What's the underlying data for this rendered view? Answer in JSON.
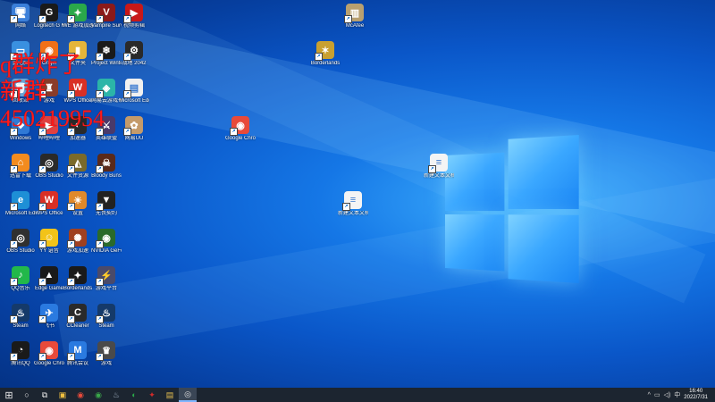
{
  "desktop": {
    "icons": [
      {
        "id": "c1r1",
        "label": "网络",
        "glyph": "🖥",
        "color": "#3b7fd9"
      },
      {
        "id": "c2r1",
        "label": "Logitech G HUB",
        "glyph": "G",
        "color": "#1a1a1a"
      },
      {
        "id": "c3r1",
        "label": "WE 游戏加速器",
        "glyph": "✦",
        "color": "#2aa84a"
      },
      {
        "id": "c4r1",
        "label": "Vampire Survivors",
        "glyph": "V",
        "color": "#8b1a1a"
      },
      {
        "id": "c5r1",
        "label": "视频剪辑",
        "glyph": "▶",
        "color": "#c81818"
      },
      {
        "id": "c1r2",
        "label": "此电脑",
        "glyph": "▭",
        "color": "#3a90e0"
      },
      {
        "id": "c2r2",
        "label": "Origin",
        "glyph": "◉",
        "color": "#f07018"
      },
      {
        "id": "c3r2",
        "label": "文件夹",
        "glyph": "▮",
        "color": "#e5b53a"
      },
      {
        "id": "c4r2",
        "label": "Project Winter",
        "glyph": "❄",
        "color": "#1a1a1a"
      },
      {
        "id": "c5r2",
        "label": "战地 2042",
        "glyph": "⚙",
        "color": "#2a2a2a"
      },
      {
        "id": "c1r3",
        "label": "回收站",
        "glyph": "🗑",
        "color": "#6aa6d6"
      },
      {
        "id": "c2r3",
        "label": "游戏",
        "glyph": "♜",
        "color": "#8a3c2a"
      },
      {
        "id": "c3r3",
        "label": "WPS Office",
        "glyph": "W",
        "color": "#d93025"
      },
      {
        "id": "c4r3",
        "label": "网易云游戏平台",
        "glyph": "◈",
        "color": "#2bb5a8"
      },
      {
        "id": "c5r3",
        "label": "Microsoft Edge",
        "glyph": "▤",
        "color": "#f0f0f0"
      },
      {
        "id": "c1r4",
        "label": "Windows",
        "glyph": "❖",
        "color": "#3079d6"
      },
      {
        "id": "c2r4",
        "label": "哔哩哔哩",
        "glyph": "▶",
        "color": "#e04040"
      },
      {
        "id": "c3r4",
        "label": "加速器",
        "glyph": "◐",
        "color": "#2a2a2a"
      },
      {
        "id": "c4r4",
        "label": "英雄联盟",
        "glyph": "⚔",
        "color": "#4a3a6a"
      },
      {
        "id": "c5r4",
        "label": "网易UU",
        "glyph": "✿",
        "color": "#c49a6a"
      },
      {
        "id": "c1r5",
        "label": "迅雷下载",
        "glyph": "⌂",
        "color": "#f28b1e"
      },
      {
        "id": "c2r5",
        "label": "OBS Studio",
        "glyph": "◎",
        "color": "#2a2a2a"
      },
      {
        "id": "c3r5",
        "label": "文件资源",
        "glyph": "◭",
        "color": "#7a6a2a"
      },
      {
        "id": "c4r5",
        "label": "Bloody Buns",
        "glyph": "☠",
        "color": "#5a2a1a"
      },
      {
        "id": "c1r6",
        "label": "Microsoft Edge",
        "glyph": "e",
        "color": "#1e8fd6"
      },
      {
        "id": "c2r6",
        "label": "WPS Office",
        "glyph": "W",
        "color": "#d93025"
      },
      {
        "id": "c3r6",
        "label": "设置",
        "glyph": "☀",
        "color": "#e0892a"
      },
      {
        "id": "c4r6",
        "label": "无畏契约",
        "glyph": "▼",
        "color": "#222"
      },
      {
        "id": "c1r7",
        "label": "OBS Studio",
        "glyph": "◎",
        "color": "#303030"
      },
      {
        "id": "c2r7",
        "label": "YY 语音",
        "glyph": "☺",
        "color": "#f2c318"
      },
      {
        "id": "c3r7",
        "label": "游戏加速",
        "glyph": "✺",
        "color": "#a04020"
      },
      {
        "id": "c4r7",
        "label": "NVIDIA GeForce",
        "glyph": "◉",
        "color": "#2a6a2a"
      },
      {
        "id": "c1r8",
        "label": "QQ音乐",
        "glyph": "♪",
        "color": "#22b84a"
      },
      {
        "id": "c2r8",
        "label": "Edge Game",
        "glyph": "▲",
        "color": "#1a1a1a"
      },
      {
        "id": "c3r8",
        "label": "Borderlands",
        "glyph": "✦",
        "color": "#1a1a1a"
      },
      {
        "id": "c4r8",
        "label": "游戏平台",
        "glyph": "⚡",
        "color": "#4a4a6a"
      },
      {
        "id": "c1r9",
        "label": "Steam",
        "glyph": "♨",
        "color": "#153a6a"
      },
      {
        "id": "c2r9",
        "label": "飞书",
        "glyph": "✈",
        "color": "#2a7ae0"
      },
      {
        "id": "c3r9",
        "label": "CCleaner",
        "glyph": "C",
        "color": "#2a2a2a"
      },
      {
        "id": "c4r9",
        "label": "Steam",
        "glyph": "♨",
        "color": "#153a6a"
      },
      {
        "id": "c1r10",
        "label": "腾讯QQ",
        "glyph": "◔",
        "color": "#1a1a1a"
      },
      {
        "id": "c2r10",
        "label": "Google Chrome",
        "glyph": "◉",
        "color": "#e84a3a"
      },
      {
        "id": "c3r10",
        "label": "腾讯会议",
        "glyph": "M",
        "color": "#2a7ae0"
      },
      {
        "id": "c4r10",
        "label": "游戏",
        "glyph": "♛",
        "color": "#4a4a4a"
      },
      {
        "id": "chrome",
        "label": "Google Chrome",
        "glyph": "◉",
        "color": "#e84a3a"
      },
      {
        "id": "mcafee",
        "label": "McAfee",
        "glyph": "▥",
        "color": "#b8a070"
      },
      {
        "id": "game2",
        "label": "Borderlands",
        "glyph": "✶",
        "color": "#c8a030"
      },
      {
        "id": "doc1",
        "label": "新建文本文档",
        "glyph": "≡",
        "color": "#f4f4f4"
      },
      {
        "id": "doc2",
        "label": "新建文本文档",
        "glyph": "≡",
        "color": "#f4f4f4"
      }
    ]
  },
  "overlay": {
    "line1": "q群炸了",
    "line2": "新群",
    "line3": "450219954"
  },
  "taskbar": {
    "start": "⊞",
    "search": "○",
    "taskview": "⧉",
    "apps": [
      {
        "name": "file-explorer",
        "glyph": "▣",
        "color": "#f0c040"
      },
      {
        "name": "chrome",
        "glyph": "◉",
        "color": "#e84a3a"
      },
      {
        "name": "wegame",
        "glyph": "◉",
        "color": "#3aa84a"
      },
      {
        "name": "steam",
        "glyph": "♨",
        "color": "#a0b0c0"
      },
      {
        "name": "store",
        "glyph": "◐",
        "color": "#2aa84a"
      },
      {
        "name": "valorant",
        "glyph": "✦",
        "color": "#d02a2a"
      },
      {
        "name": "explorer",
        "glyph": "▤",
        "color": "#e8c050"
      },
      {
        "name": "obs",
        "glyph": "◎",
        "color": "#e0e0e0"
      }
    ],
    "tray": {
      "chevron": "^",
      "network": "▭",
      "volume": "◁)",
      "ime": "中"
    },
    "clock": {
      "time": "16:40",
      "date": "2022/7/31"
    }
  }
}
